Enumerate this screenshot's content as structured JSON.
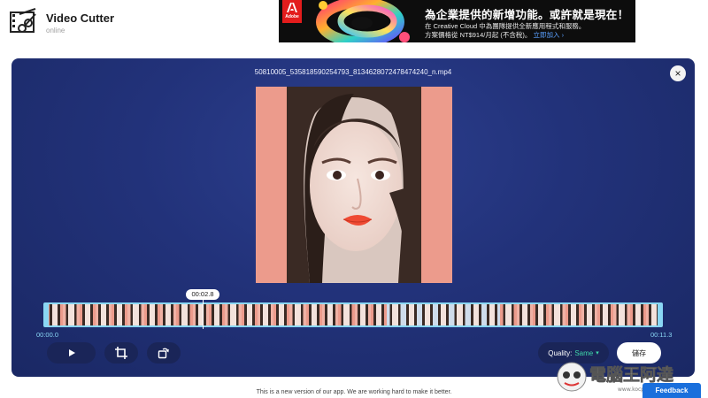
{
  "app": {
    "title": "Video Cutter",
    "subtitle": "online"
  },
  "ad": {
    "logo_text": "Adobe",
    "headline": "為企業提供的新增功能。或許就是現在！",
    "line2": "在 Creative Cloud 中為團隊提供全新應用程式和服務。",
    "line3_prefix": "方案價格從 NT$914/月起 (不含稅)。",
    "line3_cta": "立即加入 ›"
  },
  "editor": {
    "file_name": "50810005_535818590254793_8134628072478474240_n.mp4",
    "close_label": "×",
    "timeline": {
      "playhead_time": "00:02.8",
      "start_time": "00:00.0",
      "end_time": "00:11.3",
      "playhead_fraction": 0.248
    },
    "controls": {
      "quality_label": "Quality:",
      "quality_value": "Same",
      "save_label": "儲存"
    }
  },
  "footer": {
    "note": "This is a new version of our app. We are working hard to make it better.",
    "feedback_label": "Feedback"
  },
  "watermark": {
    "text": "電腦王阿達",
    "url": "www.kocpc.com.tw"
  },
  "colors": {
    "panel": "#22327a",
    "accent": "#8ad7f4",
    "quality_value": "#3fd6a8",
    "video_bg": "#ec9b8c",
    "feedback": "#1a6fdc"
  }
}
